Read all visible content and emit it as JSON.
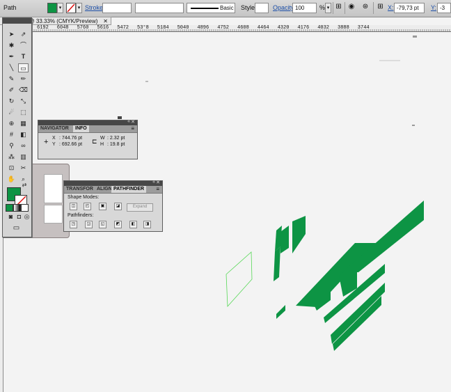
{
  "control_bar": {
    "object_type": "Path",
    "fill_color": "#0d9444",
    "stroke_label": "Stroke:",
    "stroke_profile": "Basic",
    "style_label": "Style:",
    "opacity_label": "Opacity:",
    "opacity_value": "100",
    "opacity_unit": "%",
    "x_label": "X:",
    "x_value": "-79,73 pt",
    "y_label": "Y:",
    "y_value": "-3"
  },
  "document_tab": {
    "title": "ai* @ 33.33% (CMYK/Preview)"
  },
  "ruler": {
    "ticks": [
      "6192",
      "6048",
      "5760",
      "5616",
      "5472",
      "53°8",
      "5184",
      "5040",
      "4896",
      "4752",
      "4608",
      "4464",
      "4320",
      "4176",
      "4032",
      "3888",
      "3744"
    ]
  },
  "info_panel": {
    "tab_navigator": "NAVIGATOR",
    "tab_info": "INFO",
    "x_label": "X",
    "x_value": ": 744.76 pt",
    "y_label": "Y",
    "y_value": ": 692.66 pt",
    "w_label": "W",
    "w_value": ": 2.32 pt",
    "h_label": "H",
    "h_value": ": 19.8 pt"
  },
  "pathfinder_panel": {
    "tab_transform": "TRANSFOR",
    "tab_align": "ALIGN",
    "tab_pathfinder": "PATHFINDER",
    "shape_modes_label": "Shape Modes:",
    "expand_label": "Expand",
    "pathfinders_label": "Pathfinders:"
  },
  "colors": {
    "accent_green": "#0d9444",
    "selection_green": "#56d856"
  }
}
